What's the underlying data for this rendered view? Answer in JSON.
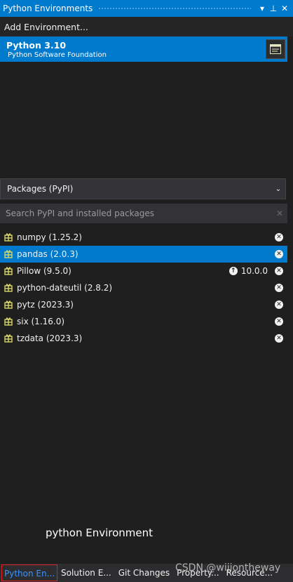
{
  "panel": {
    "title": "Python Environments",
    "controls": [
      "▾",
      "⊥",
      "✕"
    ]
  },
  "add_environment": "Add Environment...",
  "environment": {
    "name": "Python 3.10",
    "vendor": "Python Software Foundation"
  },
  "packages_dropdown": {
    "selected": "Packages (PyPI)"
  },
  "search": {
    "placeholder": "Search PyPI and installed packages"
  },
  "packages": [
    {
      "label": "numpy (1.25.2)",
      "selected": false,
      "update": ""
    },
    {
      "label": "pandas (2.0.3)",
      "selected": true,
      "update": ""
    },
    {
      "label": "Pillow (9.5.0)",
      "selected": false,
      "update": "10.0.0"
    },
    {
      "label": "python-dateutil (2.8.2)",
      "selected": false,
      "update": ""
    },
    {
      "label": "pytz (2023.3)",
      "selected": false,
      "update": ""
    },
    {
      "label": "six (1.16.0)",
      "selected": false,
      "update": ""
    },
    {
      "label": "tzdata (2023.3)",
      "selected": false,
      "update": ""
    }
  ],
  "caption": "python  Environment",
  "bottom_tabs": [
    "Python En...",
    "Solution E...",
    "Git Changes",
    "Property...",
    "Resource..."
  ],
  "watermark": "CSDN @wijiontheway",
  "colors": {
    "accent": "#007acc",
    "package_icon": "#d8d86a",
    "active_tab_border": "#e02020"
  }
}
